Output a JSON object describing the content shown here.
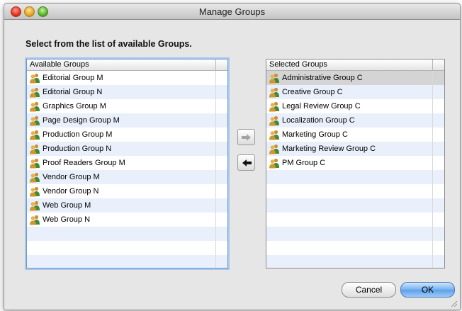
{
  "window": {
    "title": "Manage Groups"
  },
  "instruction": "Select from the list of available Groups.",
  "available": {
    "header": "Available Groups",
    "items": [
      "Editorial Group M",
      "Editorial Group N",
      "Graphics Group M",
      "Page Design Group M",
      "Production Group M",
      "Production Group N",
      "Proof Readers Group M",
      "Vendor Group M",
      "Vendor Group N",
      "Web Group M",
      "Web Group N"
    ]
  },
  "selected": {
    "header": "Selected Groups",
    "items": [
      "Administrative Group C",
      "Creative Group C",
      "Legal Review Group C",
      "Localization Group C",
      "Marketing Group C",
      "Marketing Review Group C",
      "PM Group C"
    ]
  },
  "buttons": {
    "cancel": "Cancel",
    "ok": "OK"
  },
  "icons": {
    "group": "group-icon",
    "add": "right-arrow-icon",
    "remove": "left-arrow-icon"
  },
  "colors": {
    "row_alt": "#eaf0fb",
    "selected_row": "#d4d4d4",
    "ok_button": "#74b0ef",
    "focus_ring": "#a9c7ef"
  }
}
